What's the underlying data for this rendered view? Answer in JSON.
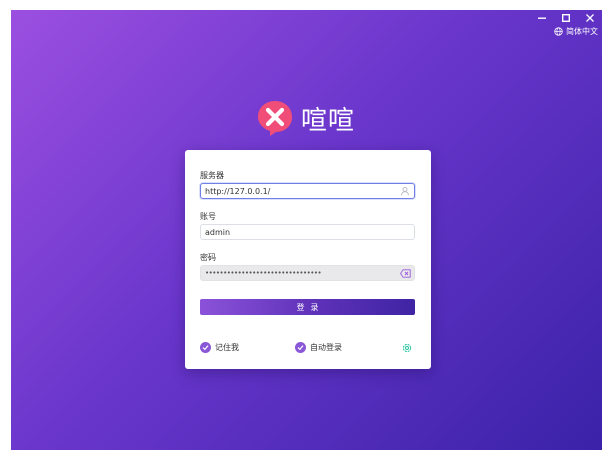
{
  "window": {
    "controls": [
      "minimize",
      "maximize",
      "close"
    ],
    "language_label": "简体中文"
  },
  "brand": {
    "name": "喧喧",
    "logo_icon": "xuanxuan-logo-icon"
  },
  "form": {
    "server_label": "服务器",
    "server_value": "http://127.0.0.1/",
    "account_label": "账号",
    "account_value": "admin",
    "password_label": "密码",
    "password_mask": "••••••••••••••••••••••••••••••••",
    "login_label": "登录",
    "remember_label": "记住我",
    "remember_checked": true,
    "auto_login_label": "自动登录",
    "auto_login_checked": true
  },
  "colors": {
    "accent": "#6a36cc",
    "gradient_start": "#9b4fe0",
    "gradient_end": "#3a22a8",
    "logo_pink": "#f04e78",
    "clear_icon": "#9b59d8",
    "settings_icon": "#2ec4a0"
  }
}
